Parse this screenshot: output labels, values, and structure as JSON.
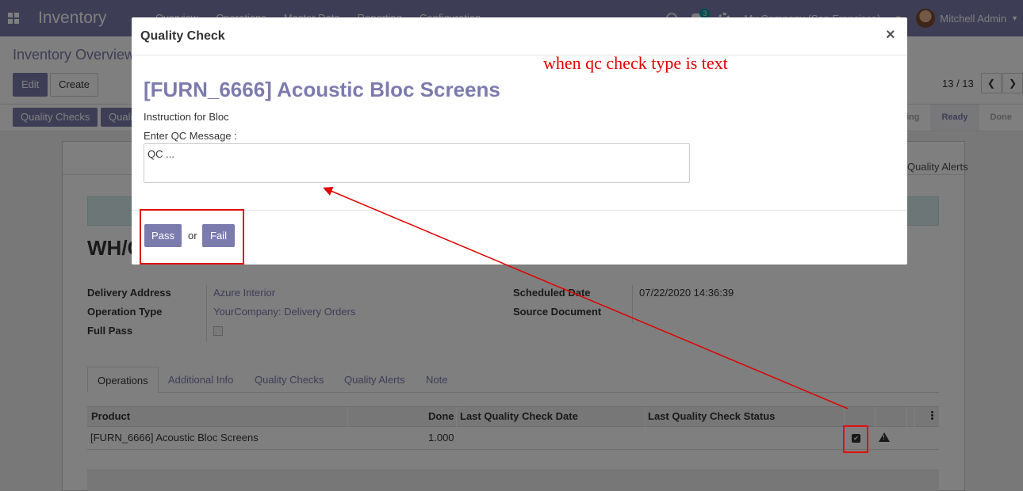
{
  "navbar": {
    "app_name": "Inventory",
    "menu": [
      "Overview",
      "Operations",
      "Master Data",
      "Reporting",
      "Configuration"
    ],
    "chat_count": "3",
    "company": "My Company (San Francisco)",
    "user": "Mitchell Admin",
    "background_color": "#7c7bad"
  },
  "control": {
    "breadcrumb": "Inventory Overview",
    "edit_label": "Edit",
    "create_label": "Create",
    "pager": "13 / 13"
  },
  "statusbar": {
    "buttons": [
      "Quality Checks",
      "Quality"
    ],
    "stages": [
      "Waiting",
      "Ready",
      "Done"
    ],
    "active_stage": "Ready"
  },
  "sheet": {
    "quality_alerts_link": "Quality Alerts",
    "record_name": "WH/OUT",
    "fields": {
      "delivery_address_label": "Delivery Address",
      "delivery_address": "Azure Interior",
      "operation_type_label": "Operation Type",
      "operation_type": "YourCompany: Delivery Orders",
      "full_pass_label": "Full Pass",
      "scheduled_date_label": "Scheduled Date",
      "scheduled_date": "07/22/2020 14:36:39",
      "source_document_label": "Source Document"
    },
    "tabs": [
      "Operations",
      "Additional Info",
      "Quality Checks",
      "Quality Alerts",
      "Note"
    ],
    "active_tab": "Operations",
    "table": {
      "headers": [
        "Product",
        "Done",
        "Last Quality Check Date",
        "Last Quality Check Status"
      ],
      "rows": [
        {
          "product": "[FURN_6666] Acoustic Bloc Screens",
          "done": "1.000",
          "last_date": "",
          "last_status": ""
        }
      ]
    }
  },
  "modal": {
    "title": "Quality Check",
    "close": "×",
    "product": "[FURN_6666] Acoustic Bloc Screens",
    "instruction": "Instruction for Bloc",
    "message_label": "Enter QC Message :",
    "message_value": "QC ...",
    "pass_label": "Pass",
    "or_text": "or",
    "fail_label": "Fail"
  },
  "annotation": {
    "text": "when qc check type is text",
    "color": "#e00000"
  }
}
